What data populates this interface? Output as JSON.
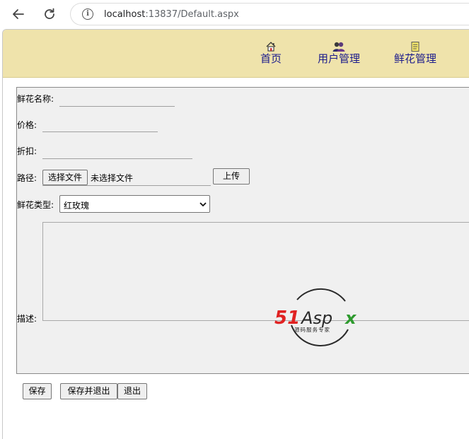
{
  "browser": {
    "url_host": "localhost",
    "url_rest": ":13837/Default.aspx"
  },
  "menu": {
    "items": [
      {
        "label": "首页",
        "icon": "home-icon"
      },
      {
        "label": "用户管理",
        "icon": "users-icon"
      },
      {
        "label": "鲜花管理",
        "icon": "notepad-icon"
      }
    ]
  },
  "form": {
    "name_label": "鲜花名称:",
    "price_label": "价格:",
    "discount_label": "折扣:",
    "path_label": "路径:",
    "choose_file_label": "选择文件",
    "no_file_text": "未选择文件",
    "upload_label": "上传",
    "type_label": "鲜花类型:",
    "type_selected": "红玫瑰",
    "desc_label": "描述:"
  },
  "logo": {
    "brand_red": "51",
    "brand_dark": "Asp",
    "brand_green": "x",
    "tagline": "源码服务专家"
  },
  "actions": {
    "save_label": "保存",
    "save_exit_label": "保存并退出",
    "exit_label": "退出"
  },
  "colors": {
    "header_bg": "#efe3ab",
    "menu_text": "#1c1c8c",
    "logo_red": "#e02222",
    "logo_green": "#2e9a2e"
  }
}
